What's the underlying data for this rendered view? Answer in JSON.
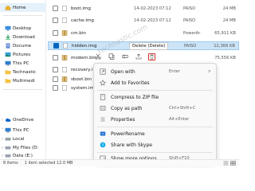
{
  "sidebar": {
    "items": [
      {
        "label": "Home",
        "icon": "home-icon",
        "selected": true
      },
      {
        "label": "Desktop",
        "icon": "desktop-icon"
      },
      {
        "label": "Download",
        "icon": "download-icon"
      },
      {
        "label": "Docume",
        "icon": "document-icon"
      },
      {
        "label": "Pictures",
        "icon": "pictures-icon"
      },
      {
        "label": "This PC",
        "icon": "this-pc-icon"
      },
      {
        "label": "Technastic",
        "icon": "folder-icon"
      },
      {
        "label": "Multimedi",
        "icon": "folder-icon"
      },
      {
        "label": "OneDrive",
        "icon": "onedrive-icon"
      },
      {
        "label": "This PC",
        "icon": "this-pc-icon"
      },
      {
        "label": "Local",
        "icon": "drive-icon"
      },
      {
        "label": "My Files (D:",
        "icon": "drive-icon"
      },
      {
        "label": "Data (E:)",
        "icon": "drive-icon"
      }
    ]
  },
  "files": [
    {
      "name": "boot.img",
      "date": "14-02-2023 07:12",
      "type": "PAISO",
      "size": "24 MB",
      "selected": false
    },
    {
      "name": "cache.img",
      "date": "14-02-2023 07:12",
      "type": "PAISO",
      "size": "24 MB",
      "selected": false
    },
    {
      "name": "cm.bin",
      "date": "",
      "type": "PowerAr",
      "size": "65,911 KB",
      "selected": false
    },
    {
      "name": "hidden.img",
      "date": "",
      "type": "PAISO",
      "size": "12,366 KB",
      "selected": true
    },
    {
      "name": "modem.bin",
      "date": "",
      "type": "",
      "size": "75,556 KB",
      "selected": false
    },
    {
      "name": "recovery.i",
      "date": "",
      "type": "",
      "size": "",
      "selected": false
    },
    {
      "name": "sboot.bin",
      "date": "",
      "type": "",
      "size": "",
      "selected": false
    },
    {
      "name": "system.img",
      "date": "",
      "type": "",
      "size": "",
      "selected": false
    }
  ],
  "tooltip": "Delete (Delete)",
  "watermark": "technastic.com",
  "context_menu": [
    {
      "label": "Open with",
      "icon": "open-with-icon",
      "arrow": ">",
      "key": ""
    },
    {
      "label": "Add to Favorites",
      "icon": "star-icon",
      "key": ""
    },
    {
      "label": "Compress to ZIP file",
      "icon": "zip-icon",
      "key": ""
    },
    {
      "label": "Copy as path",
      "icon": "copy-path-icon",
      "key": "Ctrl+Shift+C"
    },
    {
      "label": "Properties",
      "icon": "properties-icon",
      "key": "Alt+Enter"
    },
    {
      "label": "PowerRename",
      "icon": "powerrename-icon",
      "key": ""
    },
    {
      "label": "Share with Skype",
      "icon": "skype-icon",
      "key": ""
    },
    {
      "label": "Show more options",
      "icon": "more-options-icon",
      "key": "Shift+F10"
    }
  ],
  "context_enter_hint": "Enter",
  "status": {
    "items": "8 items",
    "selected": "1 item selected  12.0 MB"
  },
  "colors": {
    "accent": "#0067c0",
    "selection": "#cce4f7",
    "delete_highlight": "#d7332c"
  }
}
